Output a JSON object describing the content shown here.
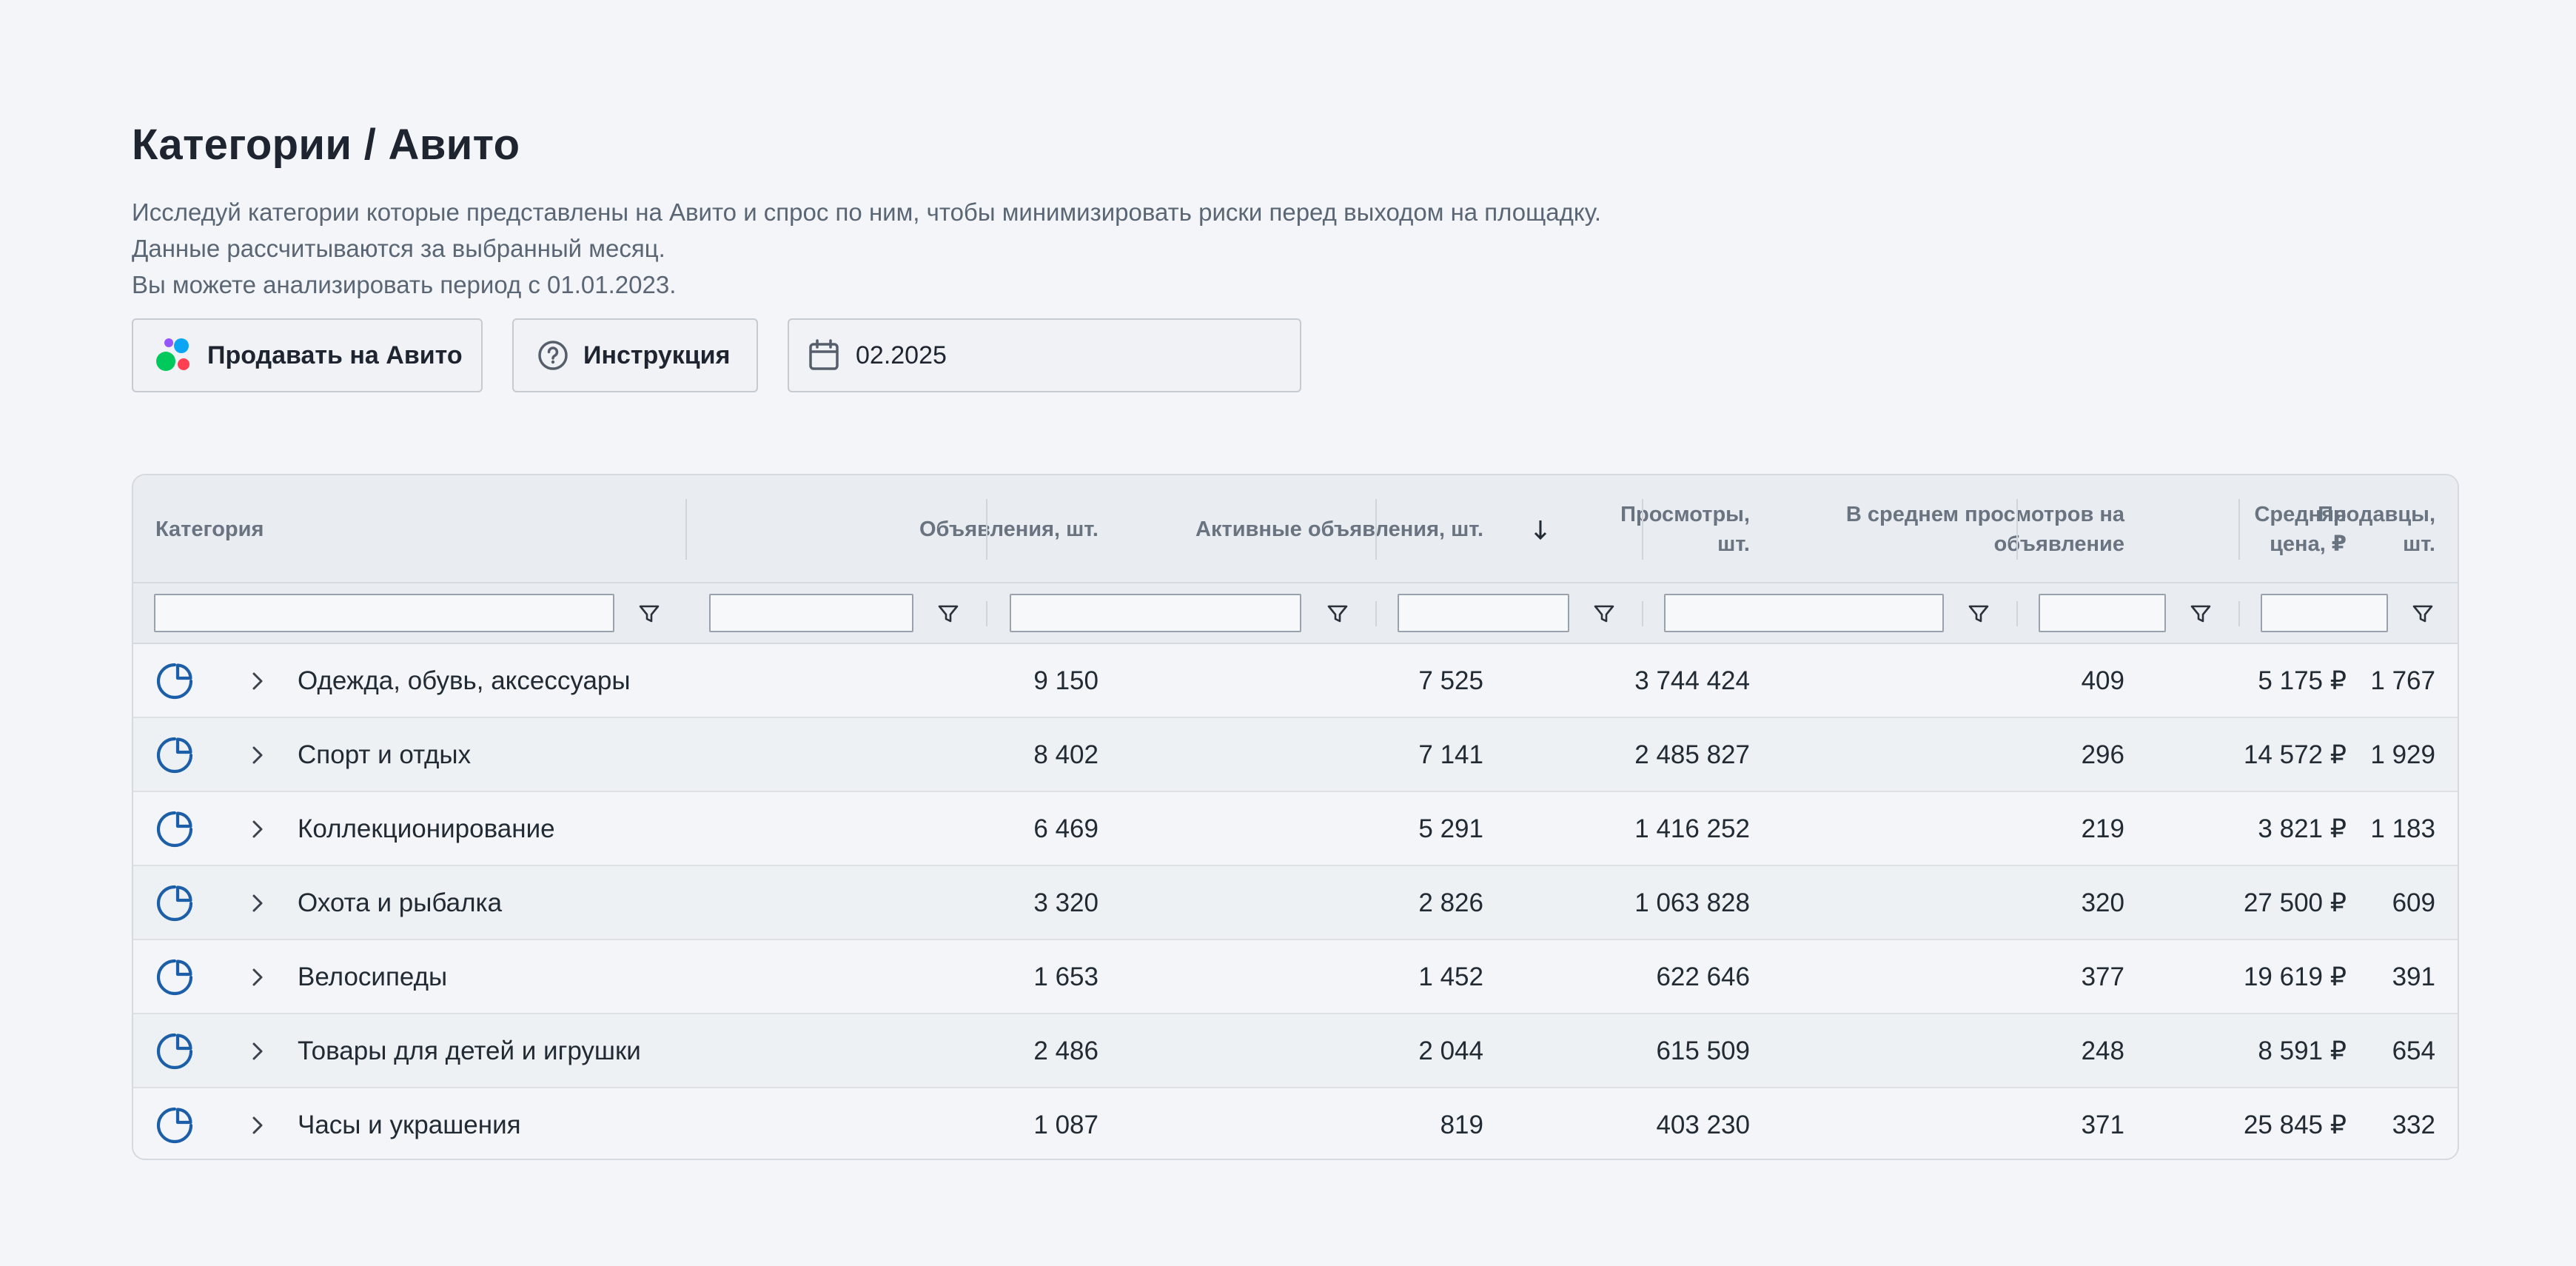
{
  "header": {
    "title": "Категории / Авито",
    "description": [
      "Исследуй категории которые представлены на Авито и спрос по ним, чтобы минимизировать риски перед выходом на площадку.",
      "Данные рассчитываются за выбранный месяц.",
      "Вы можете анализировать период с 01.01.2023."
    ]
  },
  "actions": {
    "sell_label": "Продавать на Авито",
    "help_label": "Инструкция",
    "date_value": "02.2025"
  },
  "table": {
    "columns": [
      "Категория",
      "Объявления, шт.",
      "Активные объявления, шт.",
      "Просмотры, шт.",
      "В среднем просмотров на объявление",
      "Средняя цена, ₽",
      "Продавцы, шт."
    ],
    "column_lines": {
      "views": [
        "Просмотры,",
        "шт."
      ],
      "avg_views": [
        "В среднем просмотров на",
        "объявление"
      ],
      "price": [
        "Средняя",
        "цена, ₽"
      ],
      "sellers": [
        "Продавцы,",
        "шт."
      ]
    },
    "sort_column": "Просмотры, шт.",
    "sort_direction": "desc",
    "rows": [
      {
        "category": "Одежда, обувь, аксессуары",
        "ads": "9 150",
        "active": "7 525",
        "views": "3 744 424",
        "avg": "409",
        "price": "5 175 ₽",
        "sellers": "1 767"
      },
      {
        "category": "Спорт и отдых",
        "ads": "8 402",
        "active": "7 141",
        "views": "2 485 827",
        "avg": "296",
        "price": "14 572 ₽",
        "sellers": "1 929"
      },
      {
        "category": "Коллекционирование",
        "ads": "6 469",
        "active": "5 291",
        "views": "1 416 252",
        "avg": "219",
        "price": "3 821 ₽",
        "sellers": "1 183"
      },
      {
        "category": "Охота и рыбалка",
        "ads": "3 320",
        "active": "2 826",
        "views": "1 063 828",
        "avg": "320",
        "price": "27 500 ₽",
        "sellers": "609"
      },
      {
        "category": "Велосипеды",
        "ads": "1 653",
        "active": "1 452",
        "views": "622 646",
        "avg": "377",
        "price": "19 619 ₽",
        "sellers": "391"
      },
      {
        "category": "Товары для детей и игрушки",
        "ads": "2 486",
        "active": "2 044",
        "views": "615 509",
        "avg": "248",
        "price": "8 591 ₽",
        "sellers": "654"
      },
      {
        "category": "Часы и украшения",
        "ads": "1 087",
        "active": "819",
        "views": "403 230",
        "avg": "371",
        "price": "25 845 ₽",
        "sellers": "332"
      }
    ]
  },
  "colors": {
    "accent": "#1c5fa8",
    "background": "#f3f5f8",
    "header_bg": "#e9ecf0",
    "avito_green": "#00c95b",
    "avito_blue": "#0aa6f5",
    "avito_red": "#ff4053",
    "avito_purple": "#9755ff"
  },
  "icons": {
    "row_chart": "pie-chart-icon",
    "row_expand": "chevron-right-icon",
    "filter": "filter-icon",
    "sort": "arrow-down-icon",
    "help": "question-circle-icon",
    "date": "calendar-icon"
  }
}
